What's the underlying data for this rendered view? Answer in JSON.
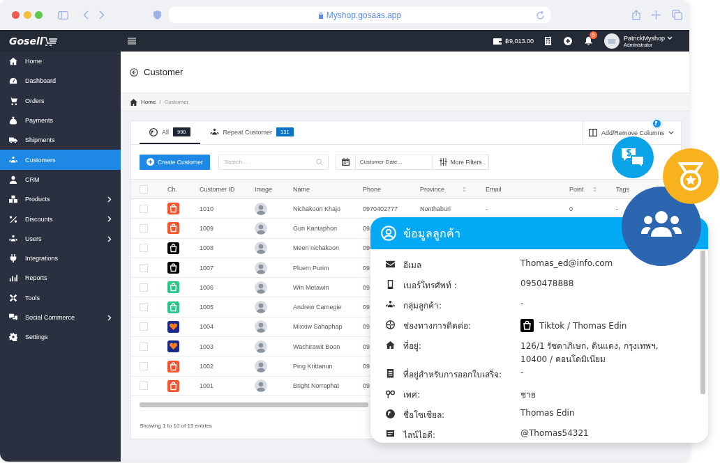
{
  "browser": {
    "url": "Myshop.gosaas.app"
  },
  "logo": "Gosell",
  "topbar": {
    "balance": "฿9,013.00",
    "notification_count": "5",
    "user_name": "PatrickMyshop",
    "user_role": "Administrator"
  },
  "sidebar": {
    "items": [
      {
        "label": "Home",
        "selected": false,
        "expandable": false
      },
      {
        "label": "Dashboard",
        "selected": false,
        "expandable": false
      },
      {
        "label": "Orders",
        "selected": false,
        "expandable": false
      },
      {
        "label": "Payments",
        "selected": false,
        "expandable": false
      },
      {
        "label": "Shipments",
        "selected": false,
        "expandable": false
      },
      {
        "label": "Customers",
        "selected": true,
        "expandable": false
      },
      {
        "label": "CRM",
        "selected": false,
        "expandable": false
      },
      {
        "label": "Products",
        "selected": false,
        "expandable": true
      },
      {
        "label": "Discounts",
        "selected": false,
        "expandable": true
      },
      {
        "label": "Users",
        "selected": false,
        "expandable": true
      },
      {
        "label": "Integrations",
        "selected": false,
        "expandable": false
      },
      {
        "label": "Reports",
        "selected": false,
        "expandable": false
      },
      {
        "label": "Tools",
        "selected": false,
        "expandable": false
      },
      {
        "label": "Social Commerce",
        "selected": false,
        "expandable": true
      },
      {
        "label": "Settings",
        "selected": false,
        "expandable": false
      }
    ]
  },
  "page": {
    "title": "Customer",
    "breadcrumb_separator": "/",
    "breadcrumb": [
      {
        "label": "Home",
        "current": false
      },
      {
        "label": "Customer",
        "current": true
      }
    ]
  },
  "tabs": [
    {
      "label": "All",
      "count": "990",
      "selected": true,
      "color": "#1f2533"
    },
    {
      "label": "Repeat Customer",
      "count": "131",
      "selected": false,
      "color": "#0a74c9"
    }
  ],
  "toolbar": {
    "create_button": "Create Customer",
    "search": {
      "placeholder": "Search..."
    },
    "date": {
      "placeholder": "Customer Date..."
    },
    "more_filters": "More Filters",
    "columns_button": "Add/Remove Columns"
  },
  "table": {
    "all_checked": false,
    "columns": [
      {
        "label": "Ch."
      },
      {
        "label": "Customer ID"
      },
      {
        "label": "Image"
      },
      {
        "label": "Name"
      },
      {
        "label": "Phone"
      },
      {
        "label": "Province",
        "sortable": true
      },
      {
        "label": "Email"
      },
      {
        "label": "Point",
        "sortable": true
      },
      {
        "label": "Tags"
      }
    ],
    "rows": [
      {
        "checked": false,
        "kind": "shopee",
        "id": "1010",
        "name": "Nichakoon Khajo",
        "phone": "0970402777",
        "province": "Nonthaburi",
        "email": "-",
        "point": "0",
        "tags": "-"
      },
      {
        "checked": false,
        "kind": "shopee",
        "id": "1009",
        "name": "Gun Kantaphon",
        "phone": "09"
      },
      {
        "checked": false,
        "kind": "tiktok",
        "id": "1008",
        "name": "Meen nichakoon",
        "phone": "09"
      },
      {
        "checked": false,
        "kind": "tiktok",
        "id": "1007",
        "name": "Pluem Purim",
        "phone": "09"
      },
      {
        "checked": false,
        "kind": "lineshop",
        "id": "1006",
        "name": "Win Metawin",
        "phone": "09"
      },
      {
        "checked": false,
        "kind": "lineshop",
        "id": "1005",
        "name": "Andrew Carnegie",
        "phone": "09"
      },
      {
        "checked": false,
        "kind": "lazada",
        "id": "1004",
        "name": "Mixxiw Sahaphap",
        "phone": "09"
      },
      {
        "checked": false,
        "kind": "lazada",
        "id": "1003",
        "name": "Wachirawit Boon",
        "phone": "09"
      },
      {
        "checked": false,
        "kind": "shopee",
        "id": "1002",
        "name": "Ping Krittanun",
        "phone": "09"
      },
      {
        "checked": false,
        "kind": "shopee",
        "id": "1001",
        "name": "Bright Norraphat",
        "phone": "09"
      }
    ]
  },
  "footer": "Showing 1 to 10 of 15 entries",
  "customer_card": {
    "title": "ข้อมูลลูกค้า",
    "fields": [
      {
        "label": "อีเมล",
        "value": "Thomas_ed@info.com"
      },
      {
        "label": "เบอร์โทรศัพท์ :",
        "value": "0950478888"
      },
      {
        "label": "กลุ่มลูกค้า:",
        "value": "-"
      },
      {
        "label": "ช่องทางการติดต่อ:",
        "value": "Tiktok / Thomas Edin",
        "kind": "tiktok"
      },
      {
        "label": "ที่อยู่:",
        "value": "126/1 รัชดาภิเษก, ดินแดง, กรุงเทพฯ, 10400 / คอนโดมิเนียม"
      },
      {
        "label": "ที่อยู่สำหรับการออกใบเสร็จ:",
        "value": "-"
      },
      {
        "label": "เพศ:",
        "value": "ชาย"
      },
      {
        "label": "ชื่อโซเชียล:",
        "value": "Thomas Edin"
      },
      {
        "label": "ไลน์ไอดี:",
        "value": "@Thomas54321"
      }
    ]
  }
}
